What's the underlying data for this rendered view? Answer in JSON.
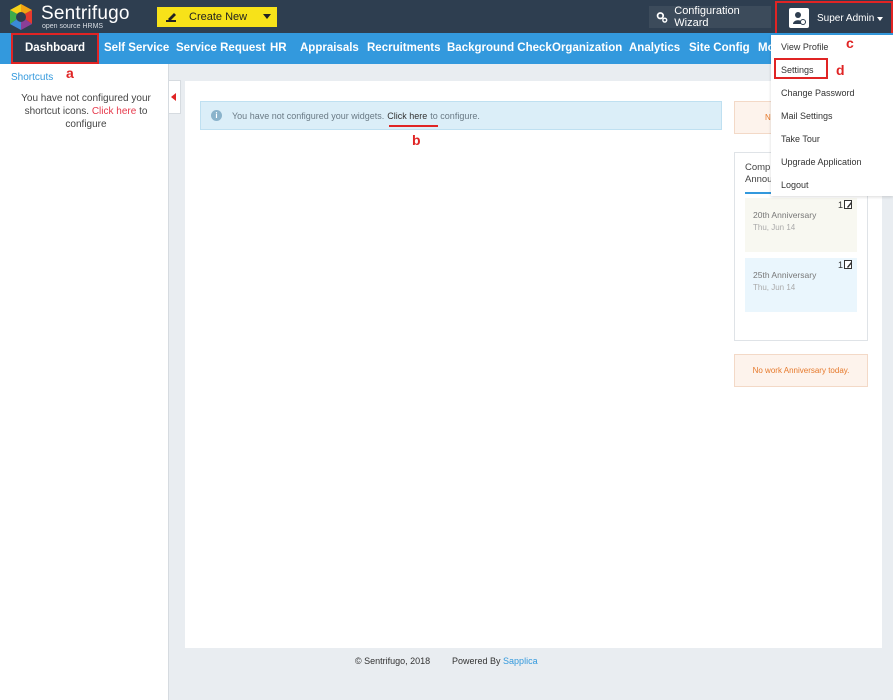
{
  "header": {
    "logo_name": "Sentrifugo",
    "logo_tagline": "open source HRMS",
    "create_new_label": "Create New",
    "config_wizard_label": "Configuration Wizard",
    "user_label": "Super Admin"
  },
  "nav": {
    "items": [
      "Dashboard",
      "Self Service",
      "Service Request",
      "HR",
      "Appraisals",
      "Recruitments",
      "Background Check",
      "Organization",
      "Analytics",
      "Site Config",
      "Mo"
    ],
    "active": "Dashboard"
  },
  "sidebar": {
    "title": "Shortcuts",
    "msg_before": "You have not configured your shortcut icons.",
    "msg_link": "Click here",
    "msg_after": "to configure"
  },
  "main": {
    "alert_before": "You have not configured your widgets.",
    "alert_link": "Click here",
    "alert_after": "to configure."
  },
  "widgets": {
    "top_text": "N",
    "anniv_tab_line1": "Comp",
    "anniv_tab_line2": "Annou",
    "cards": [
      {
        "name": "20th Anniversary",
        "date": "Thu, Jun 14",
        "count": "1",
        "bg": "#f8f8f1"
      },
      {
        "name": "25th Anniversary",
        "date": "Thu, Jun 14",
        "count": "1",
        "bg": "#eaf6fd"
      }
    ],
    "bottom_text": "No work Anniversary today."
  },
  "dropdown": {
    "items": [
      "View Profile",
      "Settings",
      "Change Password",
      "Mail Settings",
      "Take Tour",
      "Upgrade Application",
      "Logout"
    ]
  },
  "footer": {
    "copyright": "© Sentrifugo, 2018",
    "powered_by": "Powered By",
    "brand": "Sapplica"
  },
  "annotations": {
    "a": "a",
    "b": "b",
    "c": "c",
    "d": "d"
  },
  "colors": {
    "header_bg": "#2e3e50",
    "nav_bg": "#3399dd",
    "create_new": "#f7e219",
    "highlight": "#e02424"
  }
}
